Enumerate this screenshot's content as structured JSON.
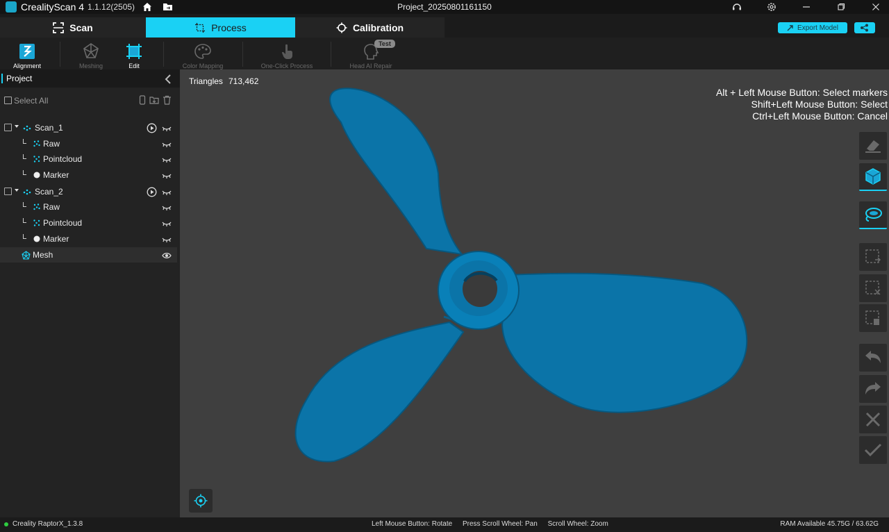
{
  "app": {
    "name": "CrealityScan 4",
    "version": "1.1.12(2505)",
    "project_title": "Project_20250801161150"
  },
  "modes": [
    {
      "label": "Scan",
      "active": false,
      "icon": "scan-frame-icon"
    },
    {
      "label": "Process",
      "active": true,
      "icon": "process-crop-icon"
    },
    {
      "label": "Calibration",
      "active": false,
      "icon": "crosshair-icon"
    }
  ],
  "header_actions": {
    "export_label": "Export Model",
    "share_icon": "share-icon"
  },
  "tools": [
    {
      "label": "Alignment",
      "enabled": true,
      "icon": "alignment-icon"
    },
    {
      "label": "Meshing",
      "enabled": false,
      "icon": "meshing-icon"
    },
    {
      "label": "Edit",
      "enabled": true,
      "icon": "edit-icon"
    },
    {
      "label": "Color Mapping",
      "enabled": false,
      "icon": "palette-icon"
    },
    {
      "label": "One-Click Process",
      "enabled": false,
      "icon": "pointer-icon"
    },
    {
      "label": "Head AI Repair",
      "enabled": false,
      "icon": "head-icon",
      "badge": "Test"
    }
  ],
  "project": {
    "title": "Project",
    "select_all": "Select All",
    "tree": [
      {
        "label": "Scan_1",
        "level": 0,
        "type": "scan"
      },
      {
        "label": "Raw",
        "level": 1,
        "type": "raw"
      },
      {
        "label": "Pointcloud",
        "level": 1,
        "type": "pointcloud"
      },
      {
        "label": "Marker",
        "level": 1,
        "type": "marker"
      },
      {
        "label": "Scan_2",
        "level": 0,
        "type": "scan"
      },
      {
        "label": "Raw",
        "level": 1,
        "type": "raw"
      },
      {
        "label": "Pointcloud",
        "level": 1,
        "type": "pointcloud"
      },
      {
        "label": "Marker",
        "level": 1,
        "type": "marker"
      },
      {
        "label": "Mesh",
        "level": 0,
        "type": "mesh"
      }
    ]
  },
  "viewport": {
    "triangles_label": "Triangles",
    "triangles_value": "713,462",
    "hints": [
      "Alt + Left Mouse Button: Select markers",
      "Shift+Left Mouse Button: Select",
      "Ctrl+Left Mouse Button: Cancel"
    ],
    "model_color": "#0b74a8"
  },
  "status": {
    "device": "Creality RaptorX_1.3.8",
    "mouse_hints": [
      "Left Mouse Button: Rotate",
      "Press Scroll Wheel: Pan",
      "Scroll Wheel: Zoom"
    ],
    "ram": "RAM Available 45.75G / 63.62G"
  },
  "colors": {
    "accent": "#1ad1f4",
    "background": "#1b1b1b",
    "viewport": "#3f3f3f",
    "ok": "#2ecc40"
  }
}
